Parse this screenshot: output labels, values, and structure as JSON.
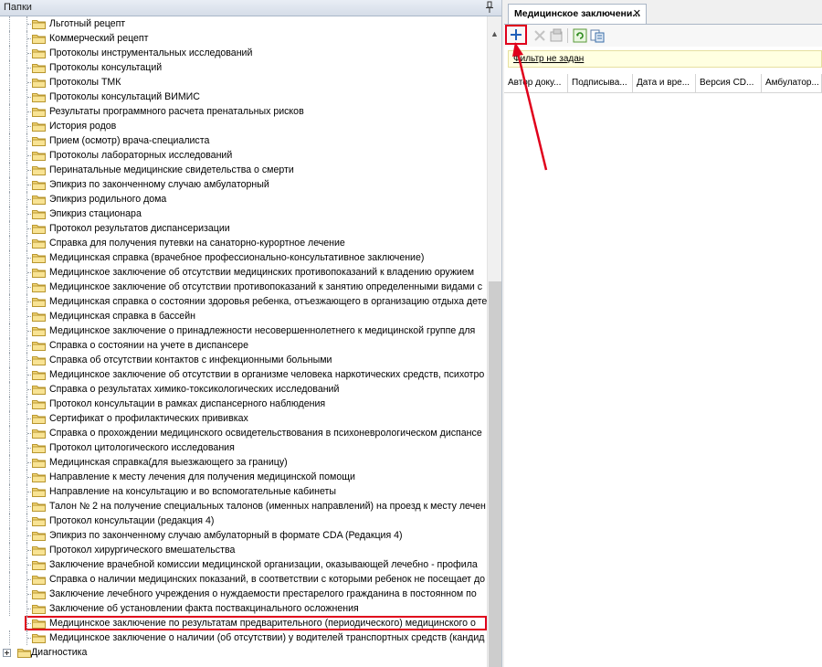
{
  "left_panel": {
    "title": "Папки",
    "folders": [
      "Льготный рецепт",
      "Коммерческий рецепт",
      "Протоколы инструментальных исследований",
      "Протоколы консультаций",
      "Протоколы ТМК",
      "Протоколы консультаций ВИМИС",
      "Результаты программного расчета пренатальных рисков",
      "История родов",
      "Прием (осмотр) врача-специалиста",
      "Протоколы лабораторных исследований",
      "Перинатальные медицинские свидетельства о смерти",
      "Эпикриз по законченному случаю амбулаторный",
      "Эпикриз родильного дома",
      "Эпикриз стационара",
      "Протокол результатов диспансеризации",
      "Справка для получения путевки на санаторно-курортное лечение",
      "Медицинская справка (врачебное профессионально-консультативное заключение)",
      "Медицинское заключение об отсутствии медицинских противопоказаний к владению оружием",
      "Медицинское заключение об отсутствии противопоказаний к занятию определенными видами с",
      "Медицинская справка о состоянии здоровья ребенка, отъезжающего в организацию отдыха дете",
      "Медицинская справка в бассейн",
      "Медицинское заключение о принадлежности несовершеннолетнего к медицинской группе для",
      "Справка о состоянии на учете в диспансере",
      "Справка об отсутствии контактов с инфекционными больными",
      "Медицинское заключение об отсутствии в организме человека наркотических средств, психотро",
      "Справка о результатах химико-токсикологических исследований",
      "Протокол консультации в рамках диспансерного наблюдения",
      "Сертификат о профилактических прививках",
      "Справка о прохождении медицинского освидетельствования в психоневрологическом диспансе",
      "Протокол цитологического исследования",
      "Медицинская справка(для выезжающего за границу)",
      "Направление к месту лечения для получения медицинской помощи",
      "Направление на консультацию и во вспомогательные кабинеты",
      "Талон № 2 на получение специальных талонов (именных направлений) на проезд к месту лечен",
      "Протокол консультации (редакция 4)",
      "Эпикриз по законченному случаю амбулаторный в формате CDA (Редакция 4)",
      "Протокол хирургического вмешательства",
      "Заключение врачебной комиссии медицинской организации, оказывающей лечебно - профила",
      "Справка о наличии медицинских показаний, в соответствии с которыми ребенок не посещает до",
      "Заключение лечебного учреждения о нуждаемости престарелого гражданина в постоянном по",
      "Заключение об установлении факта поствакцинального осложнения",
      "Медицинское заключение по результатам предварительного (периодического) медицинского о",
      "Медицинское заключение о наличии (об отсутствии) у водителей транспортных средств (кандид",
      "Диагностика"
    ],
    "selected_index": 41
  },
  "right_panel": {
    "tab_label": "Медицинское заключени...",
    "filter_text": "Фильтр не задан",
    "columns": [
      "Автор доку...",
      "Подписыва...",
      "Дата и вре...",
      "Версия CD...",
      "Амбулатор..."
    ]
  },
  "colors": {
    "highlight": "#e0001b",
    "filter_bg": "#ffffe1",
    "add_icon": "#1f5fb8"
  }
}
